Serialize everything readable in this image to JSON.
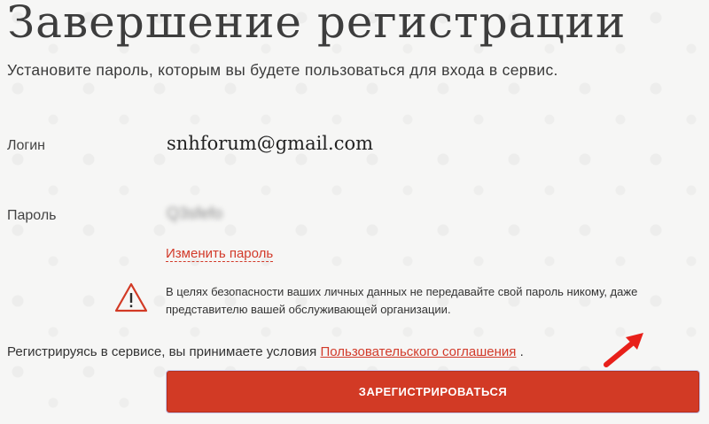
{
  "page": {
    "title": "Завершение регистрации",
    "subtitle": "Установите пароль, которым вы будете пользоваться для входа в сервис."
  },
  "form": {
    "login_label": "Логин",
    "login_value": "snhforum@gmail.com",
    "password_label": "Пароль",
    "password_value": "Q3sfefo",
    "change_password_link": "Изменить пароль"
  },
  "warning": {
    "icon": "warning-triangle-icon",
    "text": "В целях безопасности ваших личных данных не передавайте свой пароль никому, даже представителю вашей обслуживающей организации."
  },
  "terms": {
    "prefix": "Регистрируясь в сервисе, вы принимаете условия ",
    "link": "Пользовательского соглашения",
    "suffix": " ."
  },
  "register_button": {
    "label": "ЗАРЕГИСТРИРОВАТЬСЯ"
  },
  "colors": {
    "accent": "#d23a25",
    "annotation_arrow": "#e8201a"
  }
}
